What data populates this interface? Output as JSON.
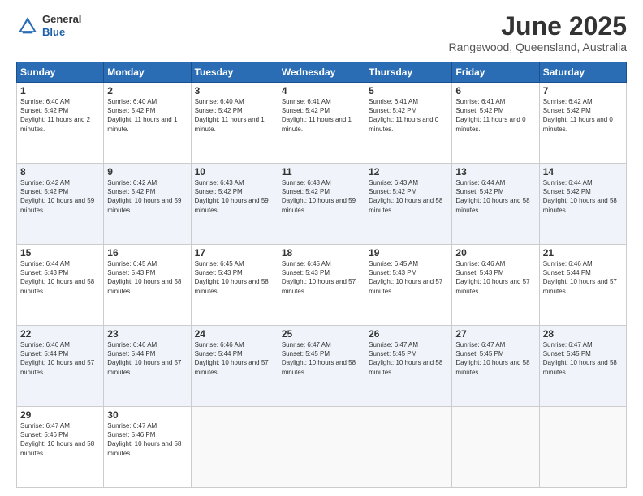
{
  "header": {
    "logo_line1": "General",
    "logo_line2": "Blue",
    "month_title": "June 2025",
    "location": "Rangewood, Queensland, Australia"
  },
  "calendar": {
    "days_of_week": [
      "Sunday",
      "Monday",
      "Tuesday",
      "Wednesday",
      "Thursday",
      "Friday",
      "Saturday"
    ],
    "weeks": [
      [
        null,
        {
          "day": "2",
          "sunrise": "6:40 AM",
          "sunset": "5:42 PM",
          "daylight": "11 hours and 1 minute."
        },
        {
          "day": "3",
          "sunrise": "6:40 AM",
          "sunset": "5:42 PM",
          "daylight": "11 hours and 1 minute."
        },
        {
          "day": "4",
          "sunrise": "6:41 AM",
          "sunset": "5:42 PM",
          "daylight": "11 hours and 1 minute."
        },
        {
          "day": "5",
          "sunrise": "6:41 AM",
          "sunset": "5:42 PM",
          "daylight": "11 hours and 0 minutes."
        },
        {
          "day": "6",
          "sunrise": "6:41 AM",
          "sunset": "5:42 PM",
          "daylight": "11 hours and 0 minutes."
        },
        {
          "day": "7",
          "sunrise": "6:42 AM",
          "sunset": "5:42 PM",
          "daylight": "11 hours and 0 minutes."
        }
      ],
      [
        {
          "day": "1",
          "sunrise": "6:40 AM",
          "sunset": "5:42 PM",
          "daylight": "11 hours and 2 minutes."
        },
        null,
        null,
        null,
        null,
        null,
        null
      ],
      [
        {
          "day": "8",
          "sunrise": "6:42 AM",
          "sunset": "5:42 PM",
          "daylight": "10 hours and 59 minutes."
        },
        {
          "day": "9",
          "sunrise": "6:42 AM",
          "sunset": "5:42 PM",
          "daylight": "10 hours and 59 minutes."
        },
        {
          "day": "10",
          "sunrise": "6:43 AM",
          "sunset": "5:42 PM",
          "daylight": "10 hours and 59 minutes."
        },
        {
          "day": "11",
          "sunrise": "6:43 AM",
          "sunset": "5:42 PM",
          "daylight": "10 hours and 59 minutes."
        },
        {
          "day": "12",
          "sunrise": "6:43 AM",
          "sunset": "5:42 PM",
          "daylight": "10 hours and 58 minutes."
        },
        {
          "day": "13",
          "sunrise": "6:44 AM",
          "sunset": "5:42 PM",
          "daylight": "10 hours and 58 minutes."
        },
        {
          "day": "14",
          "sunrise": "6:44 AM",
          "sunset": "5:42 PM",
          "daylight": "10 hours and 58 minutes."
        }
      ],
      [
        {
          "day": "15",
          "sunrise": "6:44 AM",
          "sunset": "5:43 PM",
          "daylight": "10 hours and 58 minutes."
        },
        {
          "day": "16",
          "sunrise": "6:45 AM",
          "sunset": "5:43 PM",
          "daylight": "10 hours and 58 minutes."
        },
        {
          "day": "17",
          "sunrise": "6:45 AM",
          "sunset": "5:43 PM",
          "daylight": "10 hours and 58 minutes."
        },
        {
          "day": "18",
          "sunrise": "6:45 AM",
          "sunset": "5:43 PM",
          "daylight": "10 hours and 57 minutes."
        },
        {
          "day": "19",
          "sunrise": "6:45 AM",
          "sunset": "5:43 PM",
          "daylight": "10 hours and 57 minutes."
        },
        {
          "day": "20",
          "sunrise": "6:46 AM",
          "sunset": "5:43 PM",
          "daylight": "10 hours and 57 minutes."
        },
        {
          "day": "21",
          "sunrise": "6:46 AM",
          "sunset": "5:44 PM",
          "daylight": "10 hours and 57 minutes."
        }
      ],
      [
        {
          "day": "22",
          "sunrise": "6:46 AM",
          "sunset": "5:44 PM",
          "daylight": "10 hours and 57 minutes."
        },
        {
          "day": "23",
          "sunrise": "6:46 AM",
          "sunset": "5:44 PM",
          "daylight": "10 hours and 57 minutes."
        },
        {
          "day": "24",
          "sunrise": "6:46 AM",
          "sunset": "5:44 PM",
          "daylight": "10 hours and 57 minutes."
        },
        {
          "day": "25",
          "sunrise": "6:47 AM",
          "sunset": "5:45 PM",
          "daylight": "10 hours and 58 minutes."
        },
        {
          "day": "26",
          "sunrise": "6:47 AM",
          "sunset": "5:45 PM",
          "daylight": "10 hours and 58 minutes."
        },
        {
          "day": "27",
          "sunrise": "6:47 AM",
          "sunset": "5:45 PM",
          "daylight": "10 hours and 58 minutes."
        },
        {
          "day": "28",
          "sunrise": "6:47 AM",
          "sunset": "5:45 PM",
          "daylight": "10 hours and 58 minutes."
        }
      ],
      [
        {
          "day": "29",
          "sunrise": "6:47 AM",
          "sunset": "5:46 PM",
          "daylight": "10 hours and 58 minutes."
        },
        {
          "day": "30",
          "sunrise": "6:47 AM",
          "sunset": "5:46 PM",
          "daylight": "10 hours and 58 minutes."
        },
        null,
        null,
        null,
        null,
        null
      ]
    ]
  }
}
